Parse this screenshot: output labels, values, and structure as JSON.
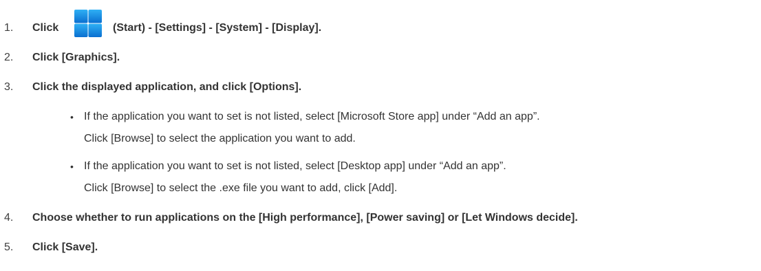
{
  "steps": [
    {
      "num": "1.",
      "text_before": "Click",
      "text_after": "(Start) - [Settings] - [System] - [Display]."
    },
    {
      "num": "2.",
      "text": "Click [Graphics]."
    },
    {
      "num": "3.",
      "text": "Click the displayed application, and click [Options]."
    },
    {
      "num": "4.",
      "text": "Choose whether to run applications on the [High performance], [Power saving] or [Let Windows decide]."
    },
    {
      "num": "5.",
      "text": "Click [Save]."
    }
  ],
  "bullets": [
    {
      "line1": "If the application you want to set is not listed, select [Microsoft Store app] under “Add an app”.",
      "line2": "Click [Browse] to select the application you want to add."
    },
    {
      "line1": "If the application you want to set is not listed, select [Desktop app] under “Add an app”.",
      "line2": "Click [Browse] to select the .exe file you want to add, click [Add]."
    }
  ],
  "icons": {
    "start": "windows-start-icon",
    "start_colors": [
      "#1fa3f0",
      "#0a74d4"
    ]
  }
}
